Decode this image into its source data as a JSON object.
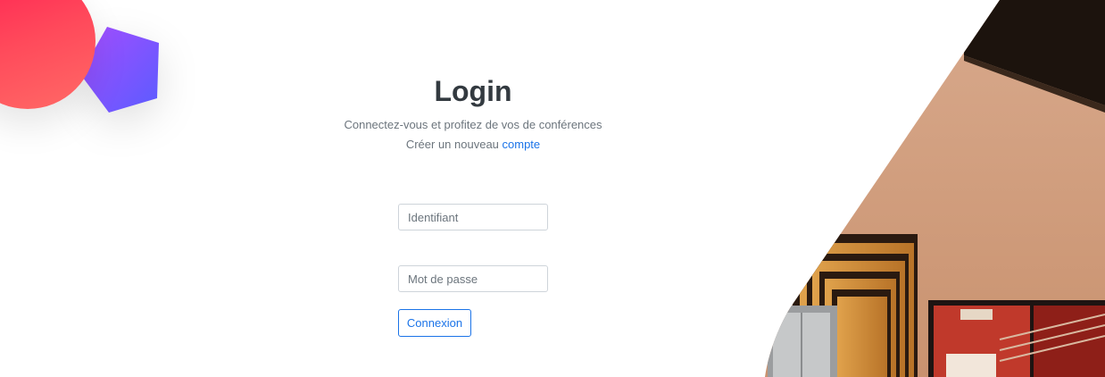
{
  "login": {
    "title": "Login",
    "subtitle": "Connectez-vous et profitez de vos de conférences",
    "create_prefix": "Créer un nouveau ",
    "create_link": "compte",
    "username_placeholder": "Identifiant",
    "password_placeholder": "Mot de passe",
    "submit_label": "Connexion"
  },
  "colors": {
    "title": "#333a40",
    "muted_text": "#6c757d",
    "link": "#1a73e8",
    "deco_circle": "#ff2152",
    "deco_polygon": "#7b4dff"
  },
  "icons": {
    "top_left_circle": "red-circle-decoration",
    "top_left_polygon": "purple-pentagon-decoration",
    "right_image": "building-interior-photo"
  }
}
